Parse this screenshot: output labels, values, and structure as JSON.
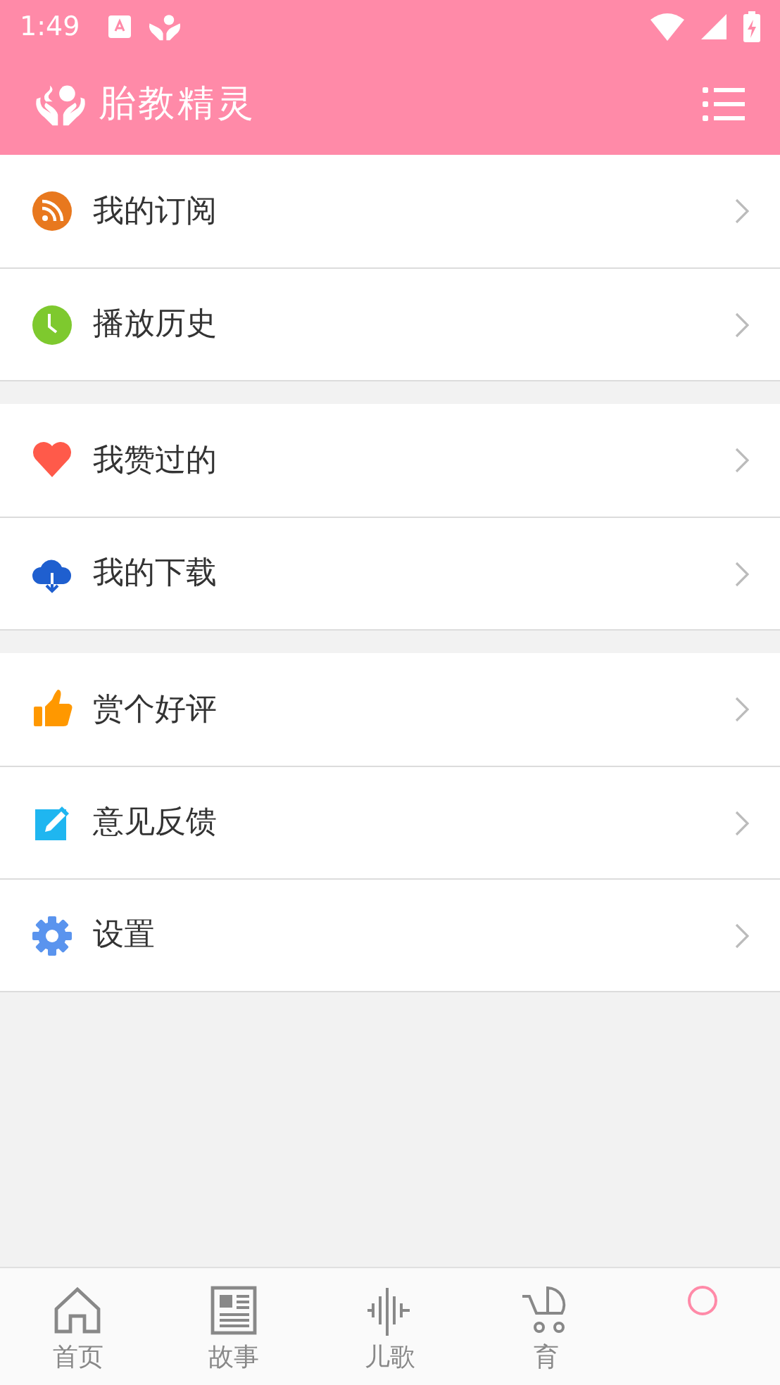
{
  "status_bar": {
    "time": "1:49"
  },
  "app_bar": {
    "title": "胎教精灵"
  },
  "menu_groups": [
    {
      "items": [
        {
          "kind": "rss",
          "label": "我的订阅"
        },
        {
          "kind": "clock",
          "label": "播放历史"
        }
      ]
    },
    {
      "items": [
        {
          "kind": "heart",
          "label": "我赞过的"
        },
        {
          "kind": "download",
          "label": "我的下载"
        }
      ]
    },
    {
      "items": [
        {
          "kind": "thumb",
          "label": "赏个好评"
        },
        {
          "kind": "edit",
          "label": "意见反馈"
        },
        {
          "kind": "gear",
          "label": "设置"
        }
      ]
    }
  ],
  "bottom_nav": [
    {
      "kind": "home",
      "label": "首页",
      "selected": false
    },
    {
      "kind": "news",
      "label": "故事",
      "selected": false
    },
    {
      "kind": "wave",
      "label": "儿歌",
      "selected": false
    },
    {
      "kind": "stroller",
      "label": "育",
      "selected": false
    },
    {
      "kind": "person",
      "selected": true
    }
  ]
}
